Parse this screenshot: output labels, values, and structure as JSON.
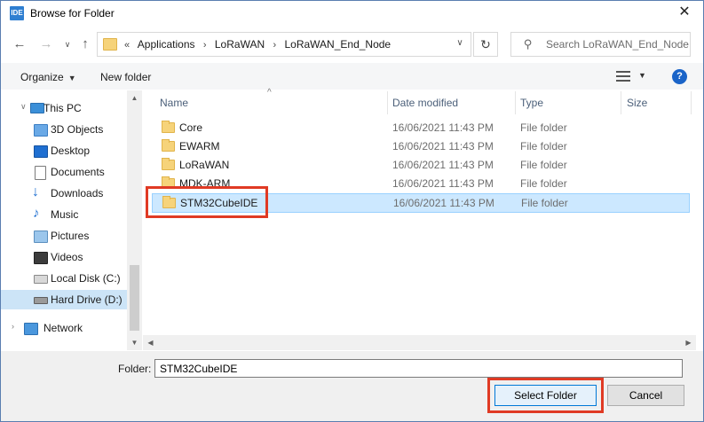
{
  "window": {
    "title": "Browse for Folder",
    "app_icon_text": "IDE"
  },
  "address_bar": {
    "crumbs": [
      "«",
      "Applications",
      "LoRaWAN",
      "LoRaWAN_End_Node"
    ],
    "search_placeholder": "Search LoRaWAN_End_Node"
  },
  "toolbar": {
    "organize_label": "Organize",
    "new_folder_label": "New folder",
    "help_label": "?"
  },
  "nav_pane": {
    "items": [
      {
        "label": "This PC",
        "icon": "this-pc-icon"
      },
      {
        "label": "3D Objects",
        "icon": "3d-objects-icon"
      },
      {
        "label": "Desktop",
        "icon": "desktop-icon"
      },
      {
        "label": "Documents",
        "icon": "documents-icon"
      },
      {
        "label": "Downloads",
        "icon": "downloads-icon"
      },
      {
        "label": "Music",
        "icon": "music-icon"
      },
      {
        "label": "Pictures",
        "icon": "pictures-icon"
      },
      {
        "label": "Videos",
        "icon": "videos-icon"
      },
      {
        "label": "Local Disk (C:)",
        "icon": "local-disk-icon"
      },
      {
        "label": "Hard Drive (D:)",
        "icon": "hard-drive-icon",
        "selected": true
      },
      {
        "label": "Network",
        "icon": "network-icon"
      }
    ]
  },
  "file_list": {
    "columns": [
      "Name",
      "Date modified",
      "Type",
      "Size"
    ],
    "rows": [
      {
        "name": "Core",
        "date": "16/06/2021 11:43 PM",
        "type": "File folder"
      },
      {
        "name": "EWARM",
        "date": "16/06/2021 11:43 PM",
        "type": "File folder"
      },
      {
        "name": "LoRaWAN",
        "date": "16/06/2021 11:43 PM",
        "type": "File folder"
      },
      {
        "name": "MDK-ARM",
        "date": "16/06/2021 11:43 PM",
        "type": "File folder"
      },
      {
        "name": "STM32CubeIDE",
        "date": "16/06/2021 11:43 PM",
        "type": "File folder",
        "selected": true
      }
    ]
  },
  "folder_field": {
    "label": "Folder:",
    "value": "STM32CubeIDE"
  },
  "buttons": {
    "select_folder": "Select Folder",
    "cancel": "Cancel"
  },
  "colors": {
    "accent": "#0078d7",
    "selection": "#cce8ff",
    "highlight_box": "#e03a24",
    "folder": "#f6d37a"
  }
}
